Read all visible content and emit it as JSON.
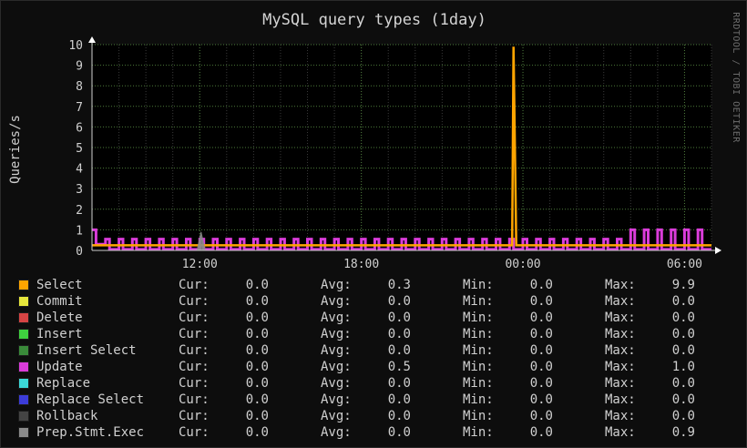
{
  "chart_data": {
    "type": "line",
    "title": "MySQL query types  (1day)",
    "ylabel": "Queries/s",
    "xlabel": "",
    "ylim": [
      0,
      10
    ],
    "y_ticks": [
      "0",
      "1",
      "2",
      "3",
      "4",
      "5",
      "6",
      "7",
      "8",
      "9",
      "10"
    ],
    "xlim_hours": [
      8.0,
      31.0
    ],
    "x_ticks": [
      {
        "label": "12:00",
        "hour": 12
      },
      {
        "label": "18:00",
        "hour": 18
      },
      {
        "label": "00:00",
        "hour": 24
      },
      {
        "label": "06:00",
        "hour": 30
      }
    ],
    "grid": true,
    "series": [
      {
        "name": "Select",
        "color": "#FFA500",
        "cur": "0.0",
        "avg": "0.3",
        "min": "0.0",
        "max": "9.9",
        "points": [
          [
            8.0,
            0.25
          ],
          [
            23.6,
            0.25
          ],
          [
            23.65,
            9.9
          ],
          [
            23.75,
            0.25
          ],
          [
            31.0,
            0.25
          ]
        ]
      },
      {
        "name": "Commit",
        "color": "#E6E63C",
        "cur": "0.0",
        "avg": "0.0",
        "min": "0.0",
        "max": "0.0",
        "points": []
      },
      {
        "name": "Delete",
        "color": "#D64444",
        "cur": "0.0",
        "avg": "0.0",
        "min": "0.0",
        "max": "0.0",
        "points": []
      },
      {
        "name": "Insert",
        "color": "#3FD13F",
        "cur": "0.0",
        "avg": "0.0",
        "min": "0.0",
        "max": "0.0",
        "points": []
      },
      {
        "name": "Insert Select",
        "color": "#3A8A3A",
        "cur": "0.0",
        "avg": "0.0",
        "min": "0.0",
        "max": "0.0",
        "points": []
      },
      {
        "name": "Update",
        "color": "#DA3CDA",
        "cur": "0.0",
        "avg": "0.5",
        "min": "0.0",
        "max": "1.0",
        "points": []
      },
      {
        "name": "Replace",
        "color": "#3CD8D8",
        "cur": "0.0",
        "avg": "0.0",
        "min": "0.0",
        "max": "0.0",
        "points": []
      },
      {
        "name": "Replace Select",
        "color": "#3C3CD8",
        "cur": "0.0",
        "avg": "0.0",
        "min": "0.0",
        "max": "0.0",
        "points": []
      },
      {
        "name": "Rollback",
        "color": "#444444",
        "cur": "0.0",
        "avg": "0.0",
        "min": "0.0",
        "max": "0.0",
        "points": []
      },
      {
        "name": "Prep.Stmt.Exec",
        "color": "#8A8A8A",
        "cur": "0.0",
        "avg": "0.0",
        "min": "0.0",
        "max": "0.9",
        "points": [
          [
            8.0,
            0.0
          ],
          [
            11.9,
            0.0
          ],
          [
            12.05,
            0.9
          ],
          [
            12.2,
            0.0
          ],
          [
            31.0,
            0.0
          ]
        ]
      }
    ],
    "update_waveform": {
      "series": "Update",
      "segments": [
        {
          "from_hour": 8.0,
          "to_hour": 8.5,
          "high": 1.0,
          "low": 0.3
        },
        {
          "from_hour": 8.5,
          "to_hour": 28.0,
          "high": 0.55,
          "low": 0.05
        },
        {
          "from_hour": 28.0,
          "to_hour": 31.0,
          "high": 1.0,
          "low": 0.05
        }
      ],
      "period_hours": 0.5
    },
    "legend_labels": {
      "cur": "Cur:",
      "avg": "Avg:",
      "min": "Min:",
      "max": "Max:"
    },
    "legend_position": "bottom"
  },
  "watermark": "RRDTOOL / TOBI OETIKER"
}
